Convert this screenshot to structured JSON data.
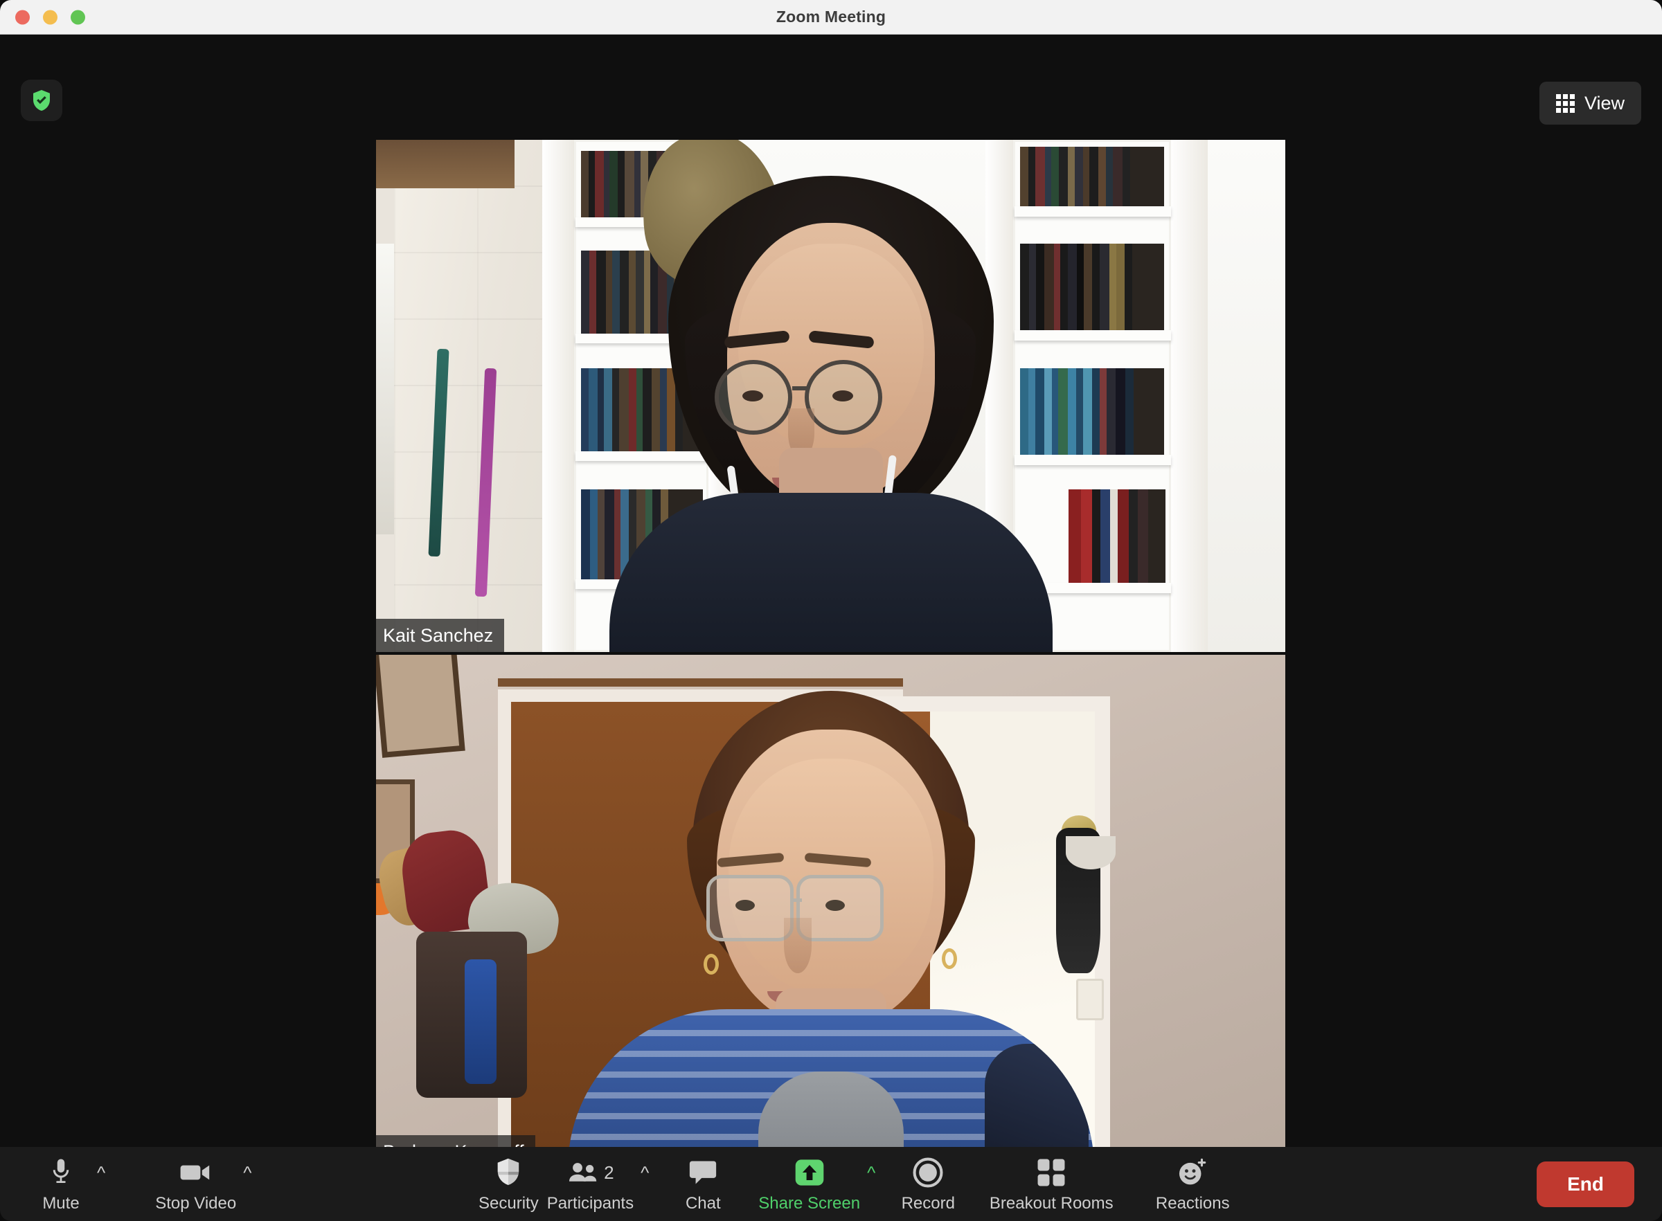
{
  "window": {
    "title": "Zoom Meeting",
    "traffic_lights": [
      "close",
      "minimize",
      "maximize"
    ]
  },
  "stage": {
    "encryption_badge_icon": "shield-check-icon",
    "view_button": {
      "label": "View",
      "icon": "grid-view-icon"
    },
    "participants": [
      {
        "name": "Kait Sanchez",
        "description": "Woman with dark curly shoulder-length hair, round wire glasses, white wired earbuds, dark navy top, seated in front of white built-in bookshelves and a painted white stone fireplace"
      },
      {
        "name": "Barbara Krasnoff",
        "description": "Woman with short brown hair, rectangular wire-rim glasses, gold hoop earrings, blue striped shirt over a gray tee, in front of a wooden door, framed picture, hanging hats and a bright doorway"
      }
    ]
  },
  "toolbar": {
    "items": [
      {
        "label": "Mute",
        "icon": "microphone-icon",
        "has_chevron": true,
        "active": false
      },
      {
        "label": "Stop Video",
        "icon": "video-camera-icon",
        "has_chevron": true,
        "active": false
      },
      {
        "label": "Security",
        "icon": "shield-icon",
        "has_chevron": false,
        "active": false
      },
      {
        "label": "Participants",
        "icon": "people-icon",
        "has_chevron": true,
        "active": false,
        "badge": "2"
      },
      {
        "label": "Chat",
        "icon": "speech-bubble-icon",
        "has_chevron": false,
        "active": false
      },
      {
        "label": "Share Screen",
        "icon": "share-arrow-up-icon",
        "has_chevron": true,
        "active": true
      },
      {
        "label": "Record",
        "icon": "record-circle-icon",
        "has_chevron": false,
        "active": false
      },
      {
        "label": "Breakout Rooms",
        "icon": "four-squares-icon",
        "has_chevron": false,
        "active": false
      },
      {
        "label": "Reactions",
        "icon": "smiley-plus-icon",
        "has_chevron": false,
        "active": false
      }
    ],
    "end_button": {
      "label": "End"
    }
  },
  "colors": {
    "share_screen_green": "#4fd06a",
    "end_red": "#c0392f",
    "toolbar_bg": "#1b1b1b",
    "stage_bg": "#0f0f0f",
    "titlebar_bg": "#f2f2f2"
  }
}
